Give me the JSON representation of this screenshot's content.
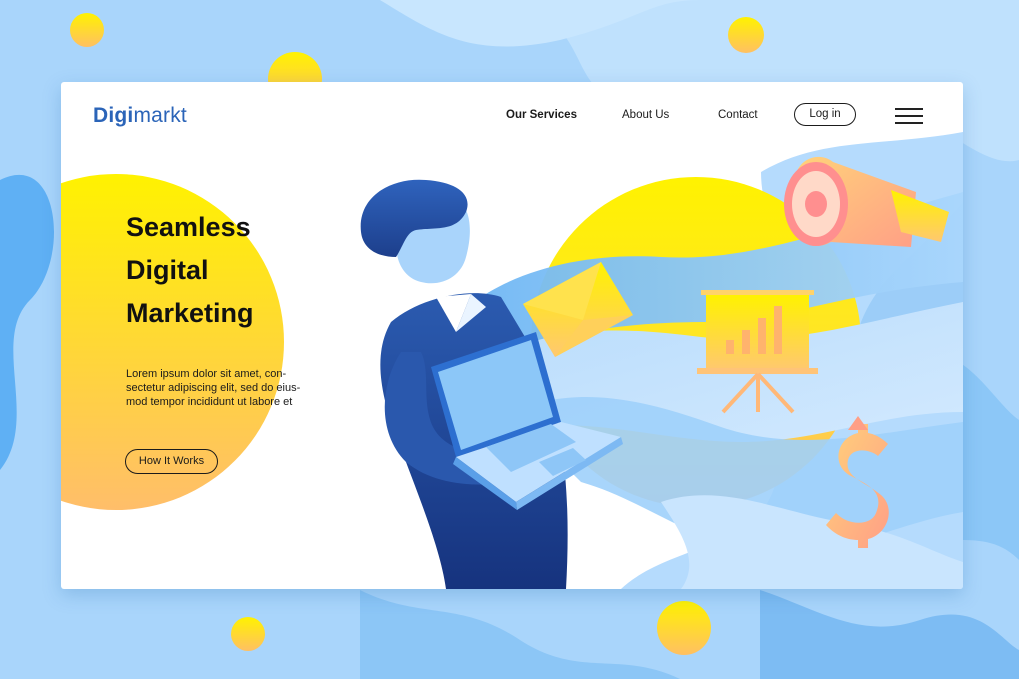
{
  "brand": {
    "logo_part1": "Digi",
    "logo_part2": "markt"
  },
  "nav": {
    "items": [
      {
        "label": "Our Services",
        "active": true
      },
      {
        "label": "About Us",
        "active": false
      },
      {
        "label": "Contact",
        "active": false
      }
    ],
    "login_label": "Log in",
    "menu_icon": "hamburger-menu-icon"
  },
  "hero": {
    "headline_lines": [
      "Seamless",
      "Digital",
      "Marketing"
    ],
    "body_lines": [
      "Lorem ipsum dolor sit amet, con-",
      "sectetur adipiscing elit, sed do eius-",
      "mod tempor incididunt ut labore et"
    ],
    "cta_label": "How It Works"
  },
  "illustration": {
    "icons": [
      "person-with-laptop",
      "envelope-icon",
      "megaphone-icon",
      "presentation-board-icon",
      "dollar-sign-icon"
    ]
  },
  "colors": {
    "brand_blue": "#2b64b8",
    "yellow": "#fff200",
    "orange": "#ffb862",
    "light_blue": "#a9d5fb",
    "navy": "#1d3f8c",
    "text": "#111111"
  }
}
